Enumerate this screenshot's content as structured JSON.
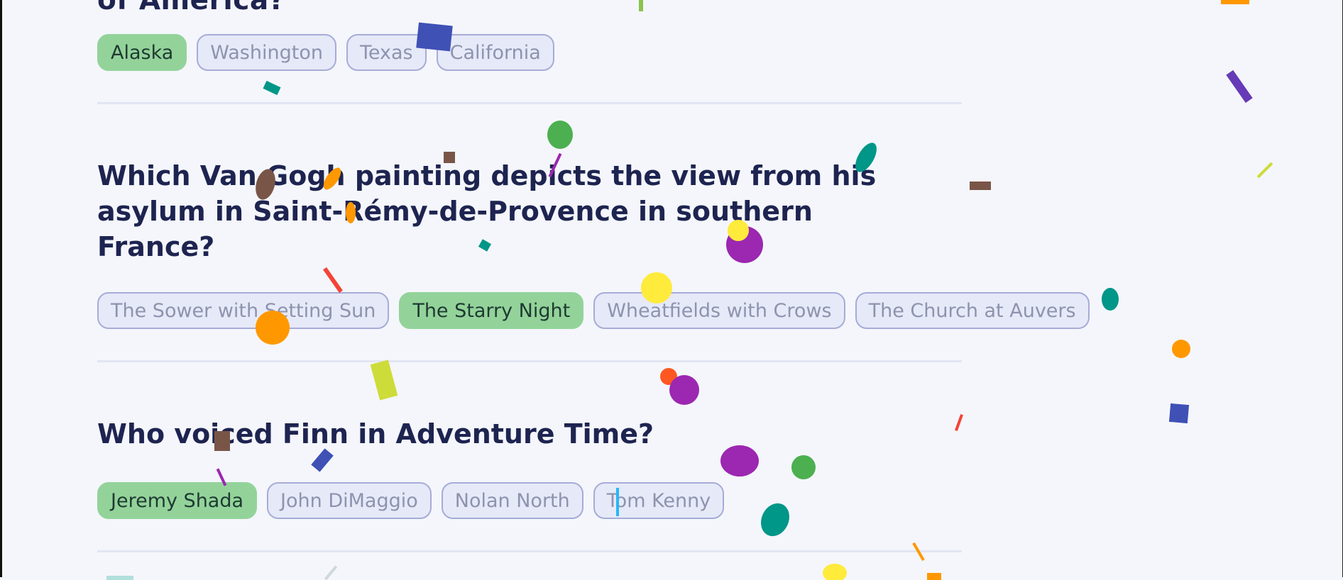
{
  "previous_question": {
    "title_fragment": "of America?",
    "options": [
      {
        "label": "Alaska",
        "correct": true
      },
      {
        "label": "Washington",
        "correct": false
      },
      {
        "label": "Texas",
        "correct": false
      },
      {
        "label": "California",
        "correct": false
      }
    ]
  },
  "questions": [
    {
      "text": "Which Van Gogh painting depicts the view from his asylum in Saint-Rémy-de-Provence in southern France?",
      "options": [
        {
          "label": "The Sower with Setting Sun",
          "correct": false
        },
        {
          "label": "The Starry Night",
          "correct": true
        },
        {
          "label": "Wheatfields with Crows",
          "correct": false
        },
        {
          "label": "The Church at Auvers",
          "correct": false
        }
      ]
    },
    {
      "text": "Who voiced Finn in Adventure Time?",
      "options": [
        {
          "label": "Jeremy Shada",
          "correct": true
        },
        {
          "label": "John DiMaggio",
          "correct": false
        },
        {
          "label": "Nolan North",
          "correct": false
        },
        {
          "label": "Tom Kenny",
          "correct": false
        }
      ]
    }
  ],
  "colors": {
    "background": "#f4f6fb",
    "question_text": "#1e2450",
    "correct_chip": "#93d39a",
    "option_chip_bg": "#e6e9f8",
    "option_chip_border": "#a6acd6",
    "option_chip_text": "#8e93ae"
  }
}
